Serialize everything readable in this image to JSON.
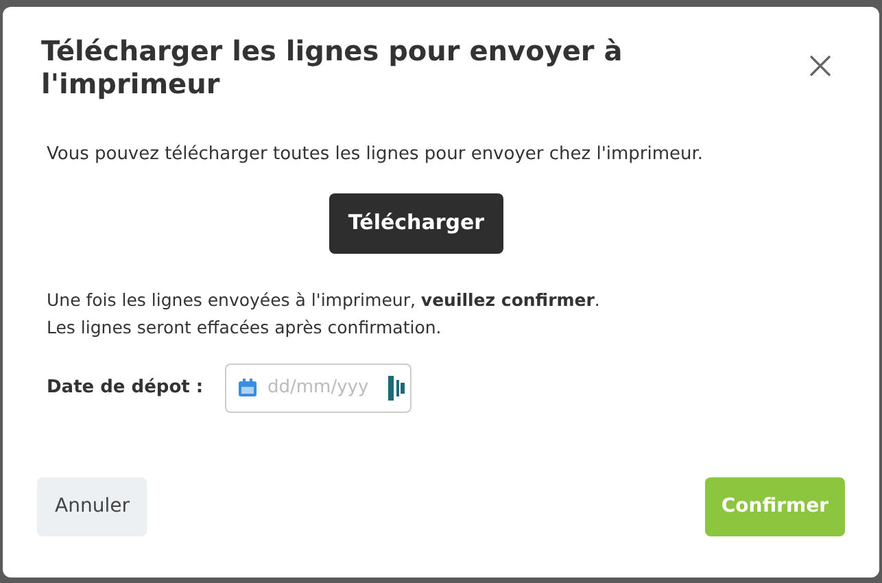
{
  "dialog": {
    "title": "Télécharger les lignes pour envoyer à l'imprimeur",
    "intro": "Vous pouvez télécharger toutes les lignes pour envoyer chez l'imprimeur.",
    "download_button": "Télécharger",
    "notes": [
      "Une fois les lignes envoyées à l'imprimeur, **veuillez confirmer**.",
      "Les lignes seront effacées après confirmation."
    ],
    "date_field": {
      "label": "Date de dépot :",
      "placeholder": "dd/mm/yyy"
    },
    "buttons": {
      "cancel": "Annuler",
      "confirm": "Confirmer"
    }
  }
}
